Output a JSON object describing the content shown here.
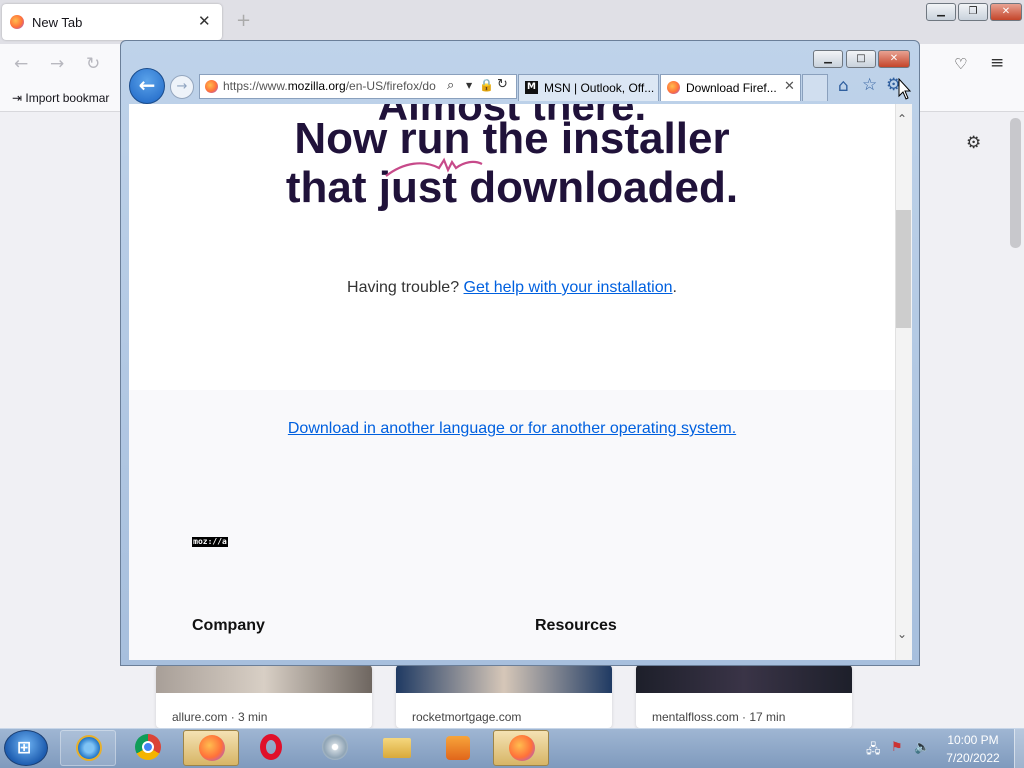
{
  "firefox": {
    "tab_title": "New Tab",
    "tab_close": "✕",
    "new_tab": "+",
    "back": "←",
    "forward": "→",
    "reload": "↻",
    "pocket": "♡",
    "menu": "≡",
    "import_bookmarks": "⇥ Import bookmar",
    "settings": "⚙",
    "window_min": "▁",
    "window_max": "❐",
    "window_close": "✕",
    "cards": [
      {
        "site": "allure.com · 3 min"
      },
      {
        "site": "rocketmortgage.com"
      },
      {
        "site": "mentalfloss.com · 17 min"
      }
    ]
  },
  "ie": {
    "window_min": "▁",
    "window_max": "□",
    "window_close": "✕",
    "back": "←",
    "forward": "→",
    "url_prefix": "https://www.",
    "url_host": "mozilla.org",
    "url_rest": "/en-US/firefox/do",
    "search": "⌕",
    "dropdown": "▼",
    "lock": "🔒",
    "refresh": "↻",
    "tabs": [
      {
        "icon": "M",
        "title": "MSN | Outlook, Off..."
      },
      {
        "title": "Download Firef...",
        "close": "✕"
      }
    ],
    "home": "⌂",
    "favorites": "☆",
    "tools": "⚙",
    "scroll_up": "⌃",
    "scroll_down": "⌄"
  },
  "page": {
    "cutoff_heading": "Almost there.",
    "heading_line1": "Now run the installer",
    "heading_line2": "that just downloaded.",
    "trouble_text": "Having trouble? ",
    "trouble_link": "Get help with your installation",
    "trouble_period": ".",
    "other_link": "Download in another language or for another operating system.",
    "logo": "moz://a",
    "footer_company": "Company",
    "footer_resources": "Resources"
  },
  "taskbar": {
    "start": "⊞",
    "items": [
      "Internet Explorer",
      "Google Chrome",
      "Firefox",
      "Opera",
      "Media Center",
      "Windows Explorer",
      "Media Player",
      "Firefox"
    ],
    "active_items": [
      2,
      7
    ],
    "time": "10:00 PM",
    "date": "7/20/2022"
  },
  "colors": {
    "heading": "#20123a",
    "link": "#0060df",
    "ie_frame": "#bfd3ea",
    "taskbar": "#8fa8c8"
  }
}
